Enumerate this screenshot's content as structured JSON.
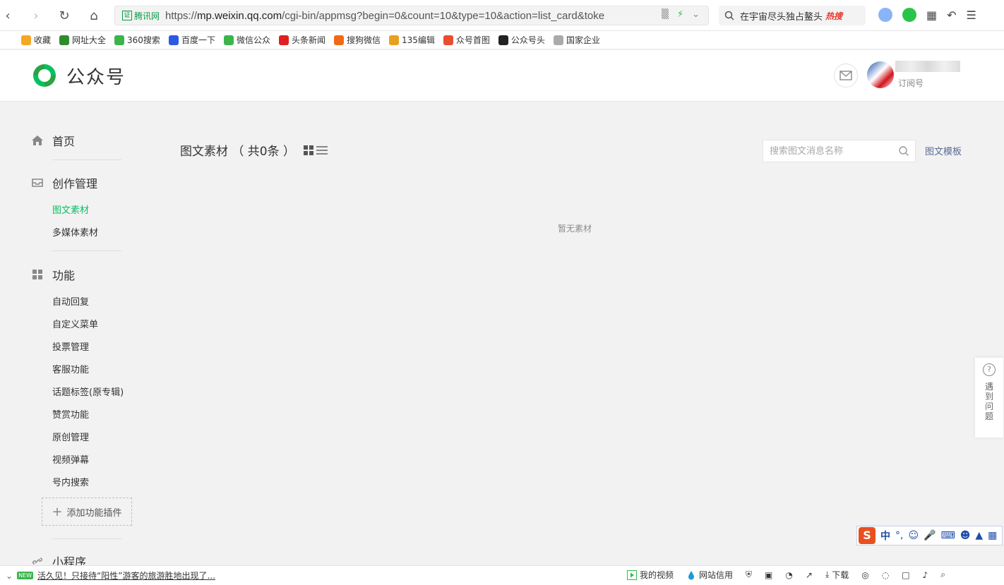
{
  "browser": {
    "cert_label": "腾讯网",
    "cert_box": "证",
    "url_host": "mp.weixin.qq.com",
    "url_prefix": "https://",
    "url_path": "/cgi-bin/appmsg?begin=0&count=10&type=10&action=list_card&toke",
    "search_text": "在宇宙尽头独占鳌头",
    "search_hot": "热搜"
  },
  "bookmarks": [
    {
      "label": "收藏",
      "color": "#f5a623"
    },
    {
      "label": "网址大全",
      "color": "#2d8c2d"
    },
    {
      "label": "360搜索",
      "color": "#3bb54a"
    },
    {
      "label": "百度一下",
      "color": "#2b5be3"
    },
    {
      "label": "微信公众",
      "color": "#3bb54a"
    },
    {
      "label": "头条新闻",
      "color": "#e02020"
    },
    {
      "label": "搜狗微信",
      "color": "#f06a16"
    },
    {
      "label": "135编辑",
      "color": "#e8a020"
    },
    {
      "label": "众号首图",
      "color": "#e94f2f"
    },
    {
      "label": "公众号头",
      "color": "#222222"
    },
    {
      "label": "国家企业",
      "color": "#aaaaaa"
    }
  ],
  "header": {
    "logo_text": "公众号",
    "account_type": "订阅号"
  },
  "sidebar": {
    "home": "首页",
    "creation": "创作管理",
    "creation_items": [
      "图文素材",
      "多媒体素材"
    ],
    "features": "功能",
    "feature_items": [
      "自动回复",
      "自定义菜单",
      "投票管理",
      "客服功能",
      "话题标签(原专辑)",
      "赞赏功能",
      "原创管理",
      "视频弹幕",
      "号内搜索"
    ],
    "add_plugin": "添加功能插件",
    "miniprogram": "小程序"
  },
  "main": {
    "title": "图文素材 （ 共0条 ）",
    "search_placeholder": "搜索图文消息名称",
    "template_link": "图文模板",
    "empty_text": "暂无素材"
  },
  "help": {
    "label": "遇到问题"
  },
  "ime": {
    "logo": "S",
    "lang": "中"
  },
  "statusbar": {
    "badge": "NEW",
    "news": "活久见！只接待“阳性”游客的旅游胜地出现了...",
    "my_video": "我的视频",
    "site_credit": "网站信用",
    "download": "下载"
  },
  "colors": {
    "accent_green": "#07c160",
    "link_blue": "#576b95"
  }
}
